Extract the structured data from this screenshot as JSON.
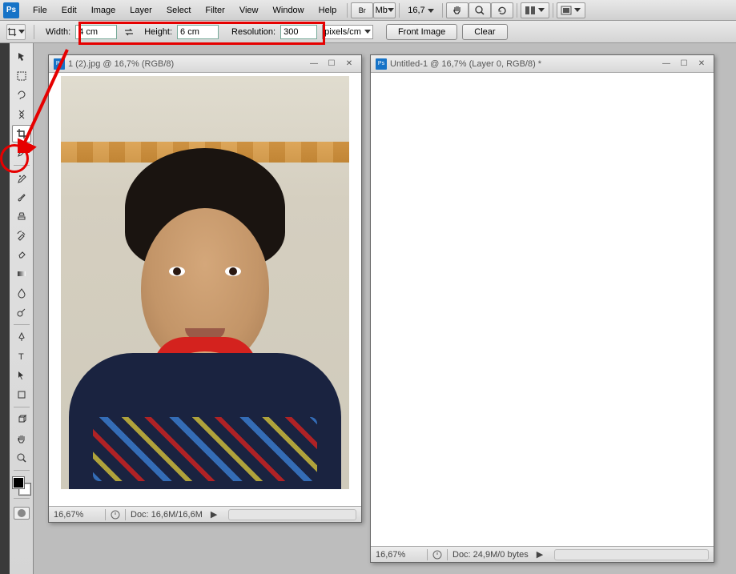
{
  "menu": {
    "items": [
      "File",
      "Edit",
      "Image",
      "Layer",
      "Select",
      "Filter",
      "View",
      "Window",
      "Help"
    ]
  },
  "top": {
    "zoom": "16,7",
    "br": "Br",
    "mb": "Mb"
  },
  "options": {
    "width_label": "Width:",
    "width_value": "4 cm",
    "height_label": "Height:",
    "height_value": "6 cm",
    "resolution_label": "Resolution:",
    "resolution_value": "300",
    "units": "pixels/cm",
    "front_image": "Front Image",
    "clear": "Clear"
  },
  "doc1": {
    "title": "1 (2).jpg @ 16,7% (RGB/8)",
    "zoom": "16,67%",
    "doc_size": "Doc: 16,6M/16,6M"
  },
  "doc2": {
    "title": "Untitled-1 @ 16,7% (Layer 0, RGB/8) *",
    "zoom": "16,67%",
    "doc_size": "Doc: 24,9M/0 bytes"
  },
  "tools": {
    "move": "move-tool",
    "marquee": "rectangular-marquee-tool",
    "lasso": "lasso-tool",
    "quickselect": "quick-selection-tool",
    "crop": "crop-tool",
    "eyedropper": "eyedropper-tool",
    "healing": "spot-healing-tool",
    "brush": "brush-tool",
    "clone": "clone-stamp-tool",
    "history": "history-brush-tool",
    "eraser": "eraser-tool",
    "gradient": "gradient-tool",
    "blur": "blur-tool",
    "dodge": "dodge-tool",
    "pen": "pen-tool",
    "type": "type-tool",
    "path": "path-selection-tool",
    "shape": "rectangle-tool",
    "view3d": "3d-tool",
    "hand": "hand-tool",
    "zoom": "zoom-tool"
  }
}
